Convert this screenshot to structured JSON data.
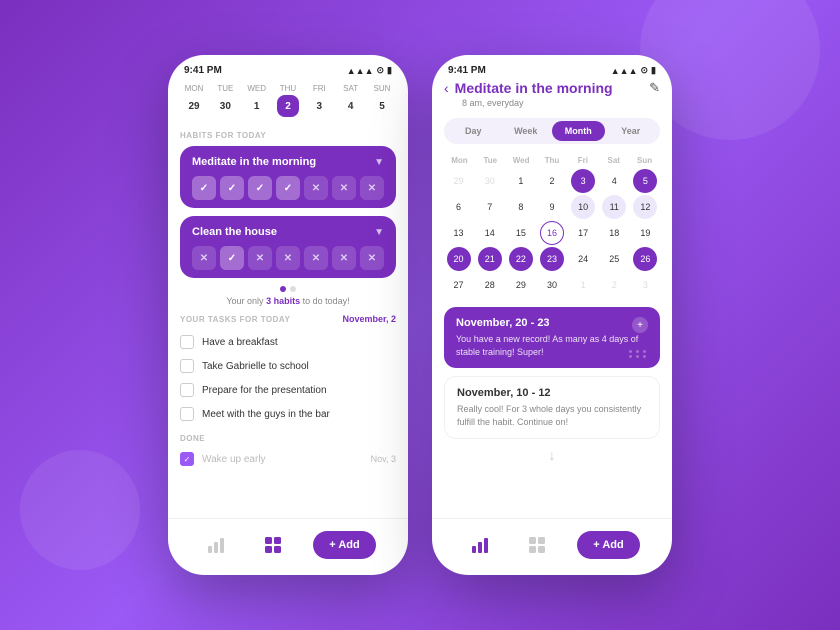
{
  "background": "#8B3FD4",
  "phone1": {
    "status_time": "9:41 PM",
    "week": {
      "days": [
        {
          "name": "Mon",
          "num": "29",
          "active": false
        },
        {
          "name": "Tue",
          "num": "30",
          "active": false
        },
        {
          "name": "Wed",
          "num": "1",
          "active": false
        },
        {
          "name": "Thu",
          "num": "2",
          "active": true
        },
        {
          "name": "Fri",
          "num": "3",
          "active": false
        },
        {
          "name": "Sat",
          "num": "4",
          "active": false
        },
        {
          "name": "Sun",
          "num": "5",
          "active": false
        }
      ]
    },
    "habits_section_label": "HABITS FOR TODAY",
    "habits": [
      {
        "title": "Meditate in the morning",
        "marks": [
          "check",
          "check",
          "check",
          "check",
          "cross",
          "cross",
          "cross"
        ]
      },
      {
        "title": "Clean the house",
        "marks": [
          "cross",
          "check",
          "cross",
          "cross",
          "cross",
          "cross",
          "cross"
        ]
      }
    ],
    "habits_summary": "Your only 3 habits to do today!",
    "tasks_label": "YOUR TASKS  FOR TODAY",
    "tasks_date": "November, 2",
    "tasks": [
      {
        "text": "Have a breakfast",
        "done": false
      },
      {
        "text": "Take Gabrielle to school",
        "done": false
      },
      {
        "text": "Prepare for the presentation",
        "done": false
      },
      {
        "text": "Meet with the guys in the bar",
        "done": false
      }
    ],
    "done_label": "DONE",
    "done_tasks": [
      {
        "text": "Wake up early",
        "date": "Nov, 3",
        "done": true
      }
    ],
    "nav": {
      "add_label": "+ Add"
    }
  },
  "phone2": {
    "status_time": "9:41 PM",
    "back_label": "‹",
    "title": "Meditate in the morning",
    "subtitle": "8 am, everyday",
    "edit_icon": "✎",
    "view_tabs": [
      "Day",
      "Week",
      "Month",
      "Year"
    ],
    "active_tab": "Month",
    "calendar": {
      "day_names": [
        "Mon",
        "Tue",
        "Wed",
        "Thu",
        "Fri",
        "Sat",
        "Sun"
      ],
      "weeks": [
        [
          {
            "num": "29",
            "type": "other-month"
          },
          {
            "num": "30",
            "type": "other-month"
          },
          {
            "num": "1",
            "type": "normal"
          },
          {
            "num": "2",
            "type": "normal"
          },
          {
            "num": "3",
            "type": "highlighted"
          },
          {
            "num": "4",
            "type": "normal"
          },
          {
            "num": "5",
            "type": "highlighted"
          }
        ],
        [
          {
            "num": "6",
            "type": "normal"
          },
          {
            "num": "7",
            "type": "normal"
          },
          {
            "num": "8",
            "type": "normal"
          },
          {
            "num": "9",
            "type": "normal"
          },
          {
            "num": "10",
            "type": "range"
          },
          {
            "num": "11",
            "type": "range"
          },
          {
            "num": "12",
            "type": "range"
          }
        ],
        [
          {
            "num": "13",
            "type": "normal"
          },
          {
            "num": "14",
            "type": "normal"
          },
          {
            "num": "15",
            "type": "normal"
          },
          {
            "num": "16",
            "type": "today"
          },
          {
            "num": "17",
            "type": "normal"
          },
          {
            "num": "18",
            "type": "normal"
          },
          {
            "num": "19",
            "type": "normal"
          }
        ],
        [
          {
            "num": "20",
            "type": "highlighted"
          },
          {
            "num": "21",
            "type": "highlighted"
          },
          {
            "num": "22",
            "type": "highlighted"
          },
          {
            "num": "23",
            "type": "highlighted"
          },
          {
            "num": "24",
            "type": "normal"
          },
          {
            "num": "25",
            "type": "normal"
          },
          {
            "num": "26",
            "type": "highlighted"
          }
        ],
        [
          {
            "num": "27",
            "type": "normal"
          },
          {
            "num": "28",
            "type": "normal"
          },
          {
            "num": "29",
            "type": "normal"
          },
          {
            "num": "30",
            "type": "normal"
          },
          {
            "num": "1",
            "type": "other-month"
          },
          {
            "num": "2",
            "type": "other-month"
          },
          {
            "num": "3",
            "type": "other-month"
          }
        ]
      ]
    },
    "streak1": {
      "title": "November, 20 - 23",
      "text": "You have a new record! As many as 4 days of stable training! Super!"
    },
    "streak2": {
      "title": "November, 10 - 12",
      "text": "Really cool! For 3 whole days you consistently fulfill the habit. Continue on!"
    },
    "nav": {
      "add_label": "+ Add"
    }
  }
}
